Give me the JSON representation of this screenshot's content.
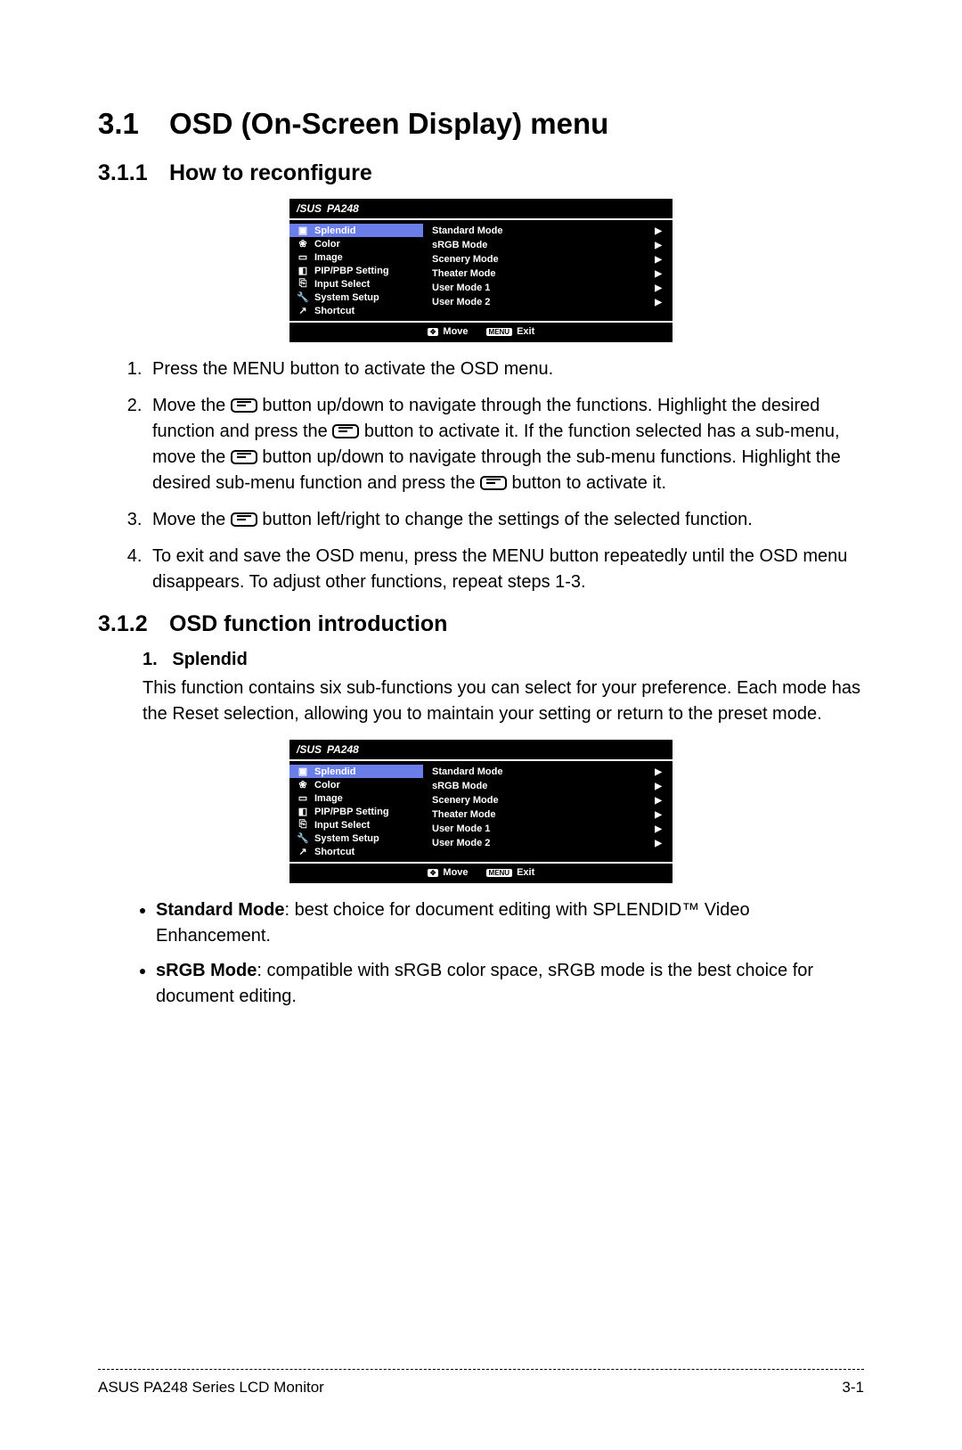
{
  "h1": {
    "num": "3.1",
    "title": "OSD (On-Screen Display) menu"
  },
  "h2a": {
    "num": "3.1.1",
    "title": "How to reconfigure"
  },
  "h2b": {
    "num": "3.1.2",
    "title": "OSD function introduction"
  },
  "osd": {
    "brand": "/SUS",
    "model": "PA248",
    "left": [
      {
        "icon": "▣",
        "label": "Splendid",
        "selected": true
      },
      {
        "icon": "❀",
        "label": "Color"
      },
      {
        "icon": "▭",
        "label": "Image"
      },
      {
        "icon": "◧",
        "label": "PIP/PBP Setting"
      },
      {
        "icon": "⎘",
        "label": "Input Select"
      },
      {
        "icon": "🔧",
        "label": "System Setup"
      },
      {
        "icon": "↗",
        "label": "Shortcut"
      }
    ],
    "right": [
      "Standard Mode",
      "sRGB Mode",
      "Scenery Mode",
      "Theater Mode",
      "User Mode 1",
      "User Mode 2"
    ],
    "footer_move": "Move",
    "footer_exit": "Exit",
    "footer_key1": "✥",
    "footer_key2": "MENU"
  },
  "steps": {
    "s1": "Press the MENU button to activate the OSD menu.",
    "s2a": "Move the ",
    "s2b": " button up/down to navigate through the functions. Highlight the desired function and press the ",
    "s2c": " button to activate it. If the function selected has a sub-menu, move the ",
    "s2d": " button up/down to navigate through the sub-menu functions. Highlight the desired sub-menu function and press the ",
    "s2e": " button to activate it.",
    "s3a": "Move the ",
    "s3b": " button left/right to change the settings of the selected function.",
    "s4": "To exit and save the OSD menu, press the MENU button repeatedly until the OSD menu disappears. To adjust other functions, repeat steps 1-3."
  },
  "splendid": {
    "heading": "1.   Splendid",
    "para": "This function contains six sub-functions you can select for your preference. Each mode has the Reset selection, allowing you to maintain your setting or return to the preset mode."
  },
  "modes": {
    "std_label": "Standard Mode",
    "std_desc": ": best choice for document editing with SPLENDID™ Video Enhancement.",
    "srgb_label": "sRGB Mode",
    "srgb_desc": ": compatible with sRGB color space, sRGB mode is the best choice for document editing."
  },
  "footer": {
    "left": "ASUS PA248 Series LCD Monitor",
    "right": "3-1"
  }
}
